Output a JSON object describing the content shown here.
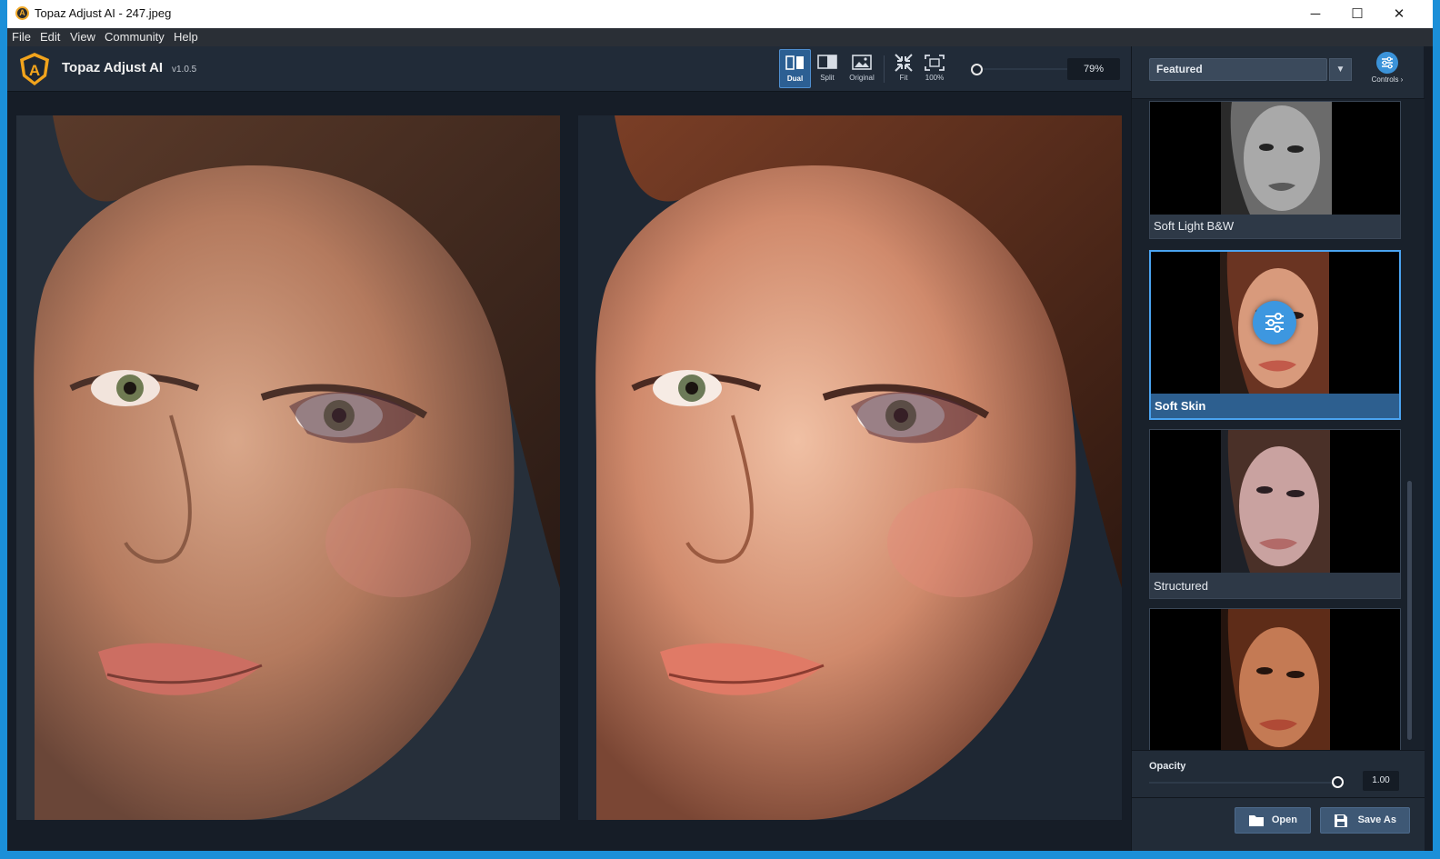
{
  "window": {
    "title": "Topaz Adjust AI - 247.jpeg",
    "controls": {
      "minimize": "─",
      "maximize": "☐",
      "close": "✕"
    }
  },
  "menu": [
    "File",
    "Edit",
    "View",
    "Community",
    "Help"
  ],
  "app": {
    "name": "Topaz Adjust AI",
    "version": "v1.0.5",
    "logo_letter": "A"
  },
  "toolbar": {
    "views": [
      {
        "label": "Dual",
        "icon": "dual-view-icon",
        "active": true
      },
      {
        "label": "Split",
        "icon": "split-view-icon",
        "active": false
      },
      {
        "label": "Original",
        "icon": "original-view-icon",
        "active": false
      }
    ],
    "zoom_buttons": [
      {
        "label": "Fit",
        "icon": "fit-icon"
      },
      {
        "label": "100%",
        "icon": "actual-size-icon"
      }
    ],
    "zoom_value": "79%",
    "zoom_level": 0.79
  },
  "sidebar": {
    "preset_category": "Featured",
    "controls_label": "Controls ›",
    "presets": [
      {
        "name": "Soft Light B&W",
        "selected": false,
        "tone": "bw"
      },
      {
        "name": "Soft Skin",
        "selected": true,
        "tone": "warm"
      },
      {
        "name": "Structured",
        "selected": false,
        "tone": "cool"
      },
      {
        "name": "",
        "selected": false,
        "tone": "deep"
      }
    ],
    "opacity_label": "Opacity",
    "opacity_value": "1.00",
    "opacity_level": 1.0,
    "open_label": "Open",
    "save_label": "Save As"
  },
  "colors": {
    "accent": "#3d97e0",
    "background": "#161d27",
    "panel": "#222c38"
  }
}
